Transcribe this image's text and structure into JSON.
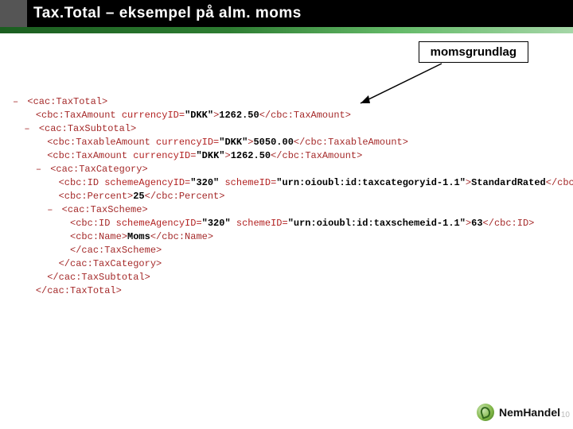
{
  "header": {
    "title": "Tax.Total – eksempel på alm. moms"
  },
  "callout": {
    "label": "momsgrundlag"
  },
  "xml": {
    "l1_open": "<cac:TaxTotal>",
    "l2_open": "<cbc:TaxAmount ",
    "l2_attr": "currencyID=",
    "l2_val": "\"DKK\"",
    "l2_mid": ">",
    "l2_txt": "1262.50",
    "l2_close": "</cbc:TaxAmount>",
    "l3_open": "<cac:TaxSubtotal>",
    "l4_open": "<cbc:TaxableAmount ",
    "l4_attr": "currencyID=",
    "l4_val": "\"DKK\"",
    "l4_mid": ">",
    "l4_txt": "5050.00",
    "l4_close": "</cbc:TaxableAmount>",
    "l5_open": "<cbc:TaxAmount ",
    "l5_attr": "currencyID=",
    "l5_val": "\"DKK\"",
    "l5_mid": ">",
    "l5_txt": "1262.50",
    "l5_close": "</cbc:TaxAmount>",
    "l6_open": "<cac:TaxCategory>",
    "l7_open": "<cbc:ID ",
    "l7_a1": "schemeAgencyID=",
    "l7_v1": "\"320\"",
    "l7_a2": " schemeID=",
    "l7_v2": "\"urn:oioubl:id:taxcategoryid-1.1\"",
    "l7_mid": ">",
    "l7_txt": "StandardRated",
    "l7_close": "</cbc:ID>",
    "l8_open": "<cbc:Percent>",
    "l8_txt": "25",
    "l8_close": "</cbc:Percent>",
    "l9_open": "<cac:TaxScheme>",
    "l10_open": "<cbc:ID ",
    "l10_a1": "schemeAgencyID=",
    "l10_v1": "\"320\"",
    "l10_a2": " schemeID=",
    "l10_v2": "\"urn:oioubl:id:taxschemeid-1.1\"",
    "l10_mid": ">",
    "l10_txt": "63",
    "l10_close": "</cbc:ID>",
    "l11_open": "<cbc:Name>",
    "l11_txt": "Moms",
    "l11_close": "</cbc:Name>",
    "l12": "</cac:TaxScheme>",
    "l13": "</cac:TaxCategory>",
    "l14": "</cac:TaxSubtotal>",
    "l15": "</cac:TaxTotal>"
  },
  "footer": {
    "brand": "NemHandel",
    "page": "10"
  }
}
